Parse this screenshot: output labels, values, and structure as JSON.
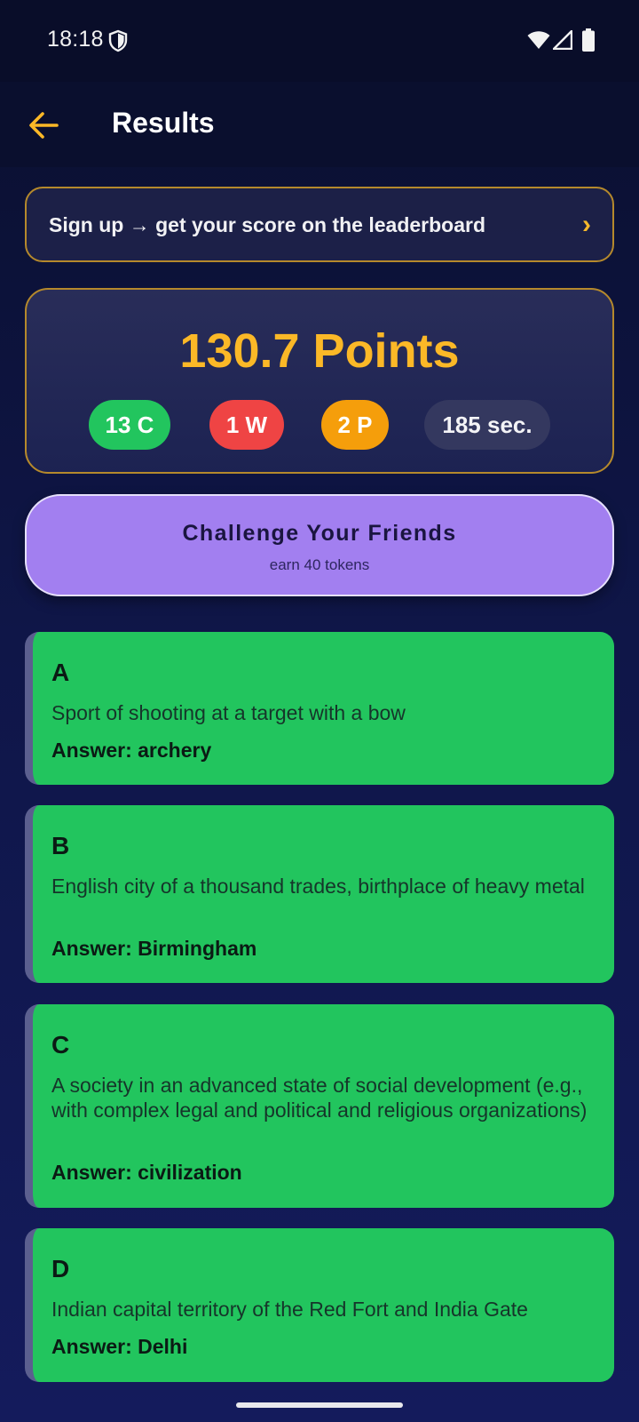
{
  "status": {
    "time": "18:18",
    "icons": [
      "shield-icon",
      "wifi-icon",
      "signal-icon",
      "battery-icon"
    ]
  },
  "header": {
    "title": "Results",
    "back_icon": "arrow-left-icon"
  },
  "signup": {
    "text": "Sign up → get your score on the leaderboard",
    "chevron": "›"
  },
  "score": {
    "points": "130.7 Points",
    "correct": "13 C",
    "wrong": "1 W",
    "partial": "2 P",
    "time": "185 sec."
  },
  "challenge": {
    "title": "Challenge Your Friends",
    "subtitle": "earn 40 tokens"
  },
  "answers": [
    {
      "letter": "A",
      "clue": "Sport of shooting at a target with a bow",
      "answer": "Answer: archery"
    },
    {
      "letter": "B",
      "clue": "English city of a thousand trades, birthplace of heavy metal",
      "answer": "Answer: Birmingham"
    },
    {
      "letter": "C",
      "clue": "A society in an advanced state of social development (e.g., with complex legal and political and religious organizations)",
      "answer": "Answer: civilization"
    },
    {
      "letter": "D",
      "clue": "Indian capital territory of the Red Fort and India Gate",
      "answer": "Answer: Delhi"
    }
  ],
  "colors": {
    "accent": "#fbb827",
    "correct": "#22c55e",
    "wrong": "#ef4444",
    "partial": "#f59e0b",
    "challenge": "#a27ff0"
  }
}
